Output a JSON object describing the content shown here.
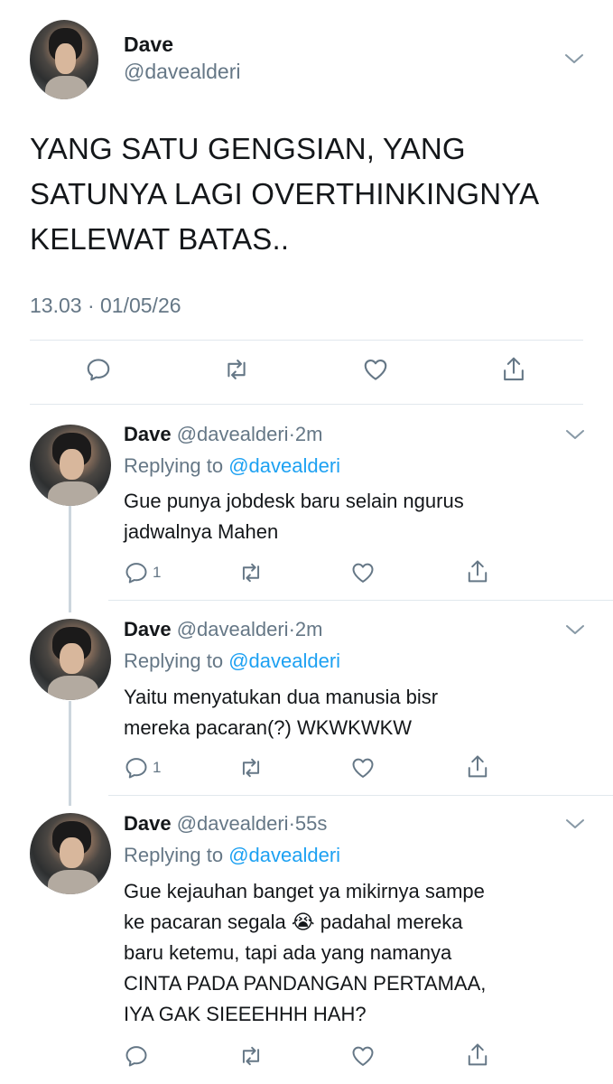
{
  "main_tweet": {
    "name": "Dave",
    "handle": "@davealderi",
    "text": "YANG SATU GENGSIAN, YANG SATUNYA LAGI OVERTHINKINGNYA KELEWAT BATAS..",
    "timestamp": "13.03 · 01/05/26"
  },
  "replies": [
    {
      "name": "Dave",
      "handle": "@davealderi",
      "time_sep": "·",
      "time": "2m",
      "replying_prefix": "Replying to",
      "replying_to": "@davealderi",
      "text_lines": [
        "Gue punya jobdesk baru selain ngurus",
        "jadwalnya Mahen"
      ],
      "reply_count": "1"
    },
    {
      "name": "Dave",
      "handle": "@davealderi",
      "time_sep": "·",
      "time": "2m",
      "replying_prefix": "Replying to",
      "replying_to": "@davealderi",
      "text_lines": [
        "Yaitu menyatukan dua manusia bisr",
        "mereka pacaran(?) WKWKWKW"
      ],
      "reply_count": "1"
    },
    {
      "name": "Dave",
      "handle": "@davealderi",
      "time_sep": "·",
      "time": "55s",
      "replying_prefix": "Replying to",
      "replying_to": "@davealderi",
      "text_lines": [
        "Gue kejauhan banget ya mikirnya sampe",
        "ke pacaran segala 😭 padahal mereka",
        "baru ketemu, tapi ada yang namanya",
        "CINTA PADA PANDANGAN PERTAMAA,",
        "IYA GAK SIEEEHHH HAH?"
      ],
      "reply_count": ""
    }
  ],
  "icons": {
    "reply": "reply-icon",
    "retweet": "retweet-icon",
    "like": "heart-icon",
    "share": "share-icon",
    "more": "chevron-down-icon"
  },
  "colors": {
    "text": "#14171a",
    "secondary": "#657786",
    "link": "#1da1f2",
    "divider": "#e1e8ed"
  }
}
